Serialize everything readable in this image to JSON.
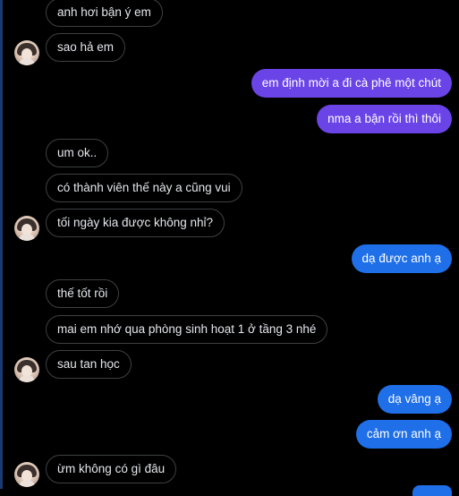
{
  "colors": {
    "background": "#000000",
    "incoming_text": "#e4e6eb",
    "incoming_border": "#3e4042",
    "outgoing_purple": "#6b44e8",
    "outgoing_blue": "#1e6fe8"
  },
  "avatar_icon": "contact-avatar",
  "messages": [
    {
      "side": "in",
      "text": "anh hơi bận ý em"
    },
    {
      "side": "in",
      "text": "sao hả em"
    },
    {
      "side": "out",
      "text": "em định mời a đi cà phê một chút"
    },
    {
      "side": "out",
      "text": "nma a bận rồi thì thôi"
    },
    {
      "side": "in",
      "text": "um ok.."
    },
    {
      "side": "in",
      "text": "có thành viên thế này a cũng vui"
    },
    {
      "side": "in",
      "text": "tối ngày kia được không nhỉ?"
    },
    {
      "side": "out",
      "text": "dạ được anh ạ"
    },
    {
      "side": "in",
      "text": "thế tốt rồi"
    },
    {
      "side": "in",
      "text": "mai em nhớ qua phòng sinh hoạt 1 ở tầng 3 nhé"
    },
    {
      "side": "in",
      "text": "sau tan học"
    },
    {
      "side": "out",
      "text": "dạ vâng ạ"
    },
    {
      "side": "out",
      "text": "cảm ơn anh ạ"
    },
    {
      "side": "in",
      "text": "ừm không có gì đâu"
    }
  ]
}
